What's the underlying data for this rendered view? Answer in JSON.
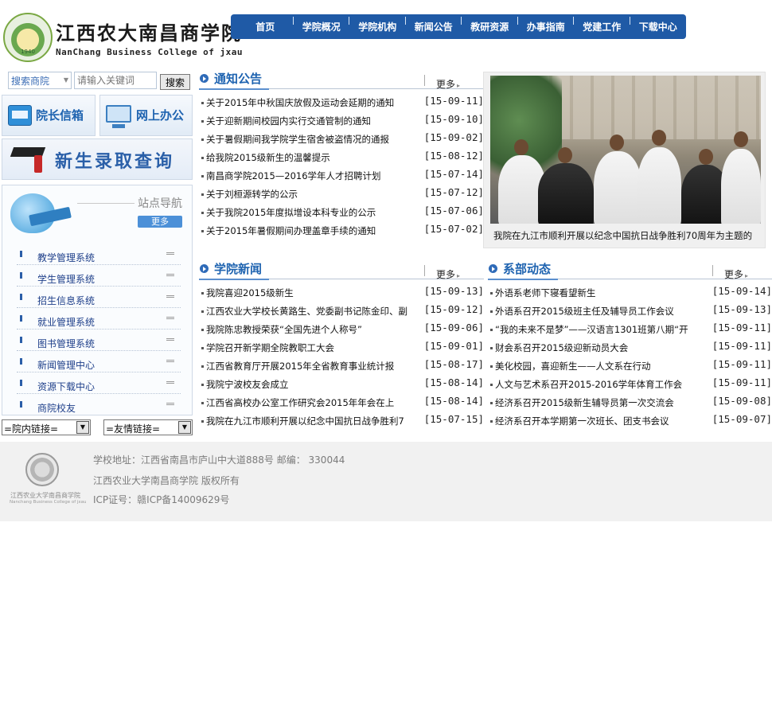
{
  "header": {
    "title_cn": "江西农大南昌商学院",
    "title_en": "NanChang Business College of jxau",
    "logo_year": "1940"
  },
  "nav": {
    "items": [
      "首页",
      "学院概况",
      "学院机构",
      "新闻公告",
      "教研资源",
      "办事指南",
      "党建工作",
      "下载中心"
    ]
  },
  "search": {
    "scope": "搜索商院",
    "placeholder": "请输入关键词",
    "button": "搜索"
  },
  "banners": {
    "president_mail": "院长信箱",
    "online_office": "网上办公",
    "admission_query": "新生录取查询"
  },
  "sitenav": {
    "title": "站点导航",
    "more": "更多",
    "items": [
      "教学管理系统",
      "学生管理系统",
      "招生信息系统",
      "就业管理系统",
      "图书管理系统",
      "新闻管理中心",
      "资源下载中心",
      "商院校友"
    ]
  },
  "link_selects": {
    "internal": "=院内链接=",
    "friend": "=友情链接="
  },
  "notice": {
    "title": "通知公告",
    "more": "更多",
    "items": [
      {
        "title": "关于2015年中秋国庆放假及运动会延期的通知",
        "date": "[15-09-11]"
      },
      {
        "title": "关于迎新期间校园内实行交通管制的通知",
        "date": "[15-09-10]"
      },
      {
        "title": "关于暑假期间我学院学生宿舍被盗情况的通报",
        "date": "[15-09-02]"
      },
      {
        "title": "给我院2015级新生的温馨提示",
        "date": "[15-08-12]"
      },
      {
        "title": "南昌商学院2015—2016学年人才招聘计划",
        "date": "[15-07-14]"
      },
      {
        "title": "关于刘桓源转学的公示",
        "date": "[15-07-12]"
      },
      {
        "title": "关于我院2015年度拟增设本科专业的公示",
        "date": "[15-07-06]"
      },
      {
        "title": "关于2015年暑假期间办理盖章手续的通知",
        "date": "[15-07-02]"
      }
    ]
  },
  "photo": {
    "caption": "我院在九江市顺利开展以纪念中国抗日战争胜利70周年为主题的"
  },
  "college_news": {
    "title": "学院新闻",
    "more": "更多",
    "items": [
      {
        "title": "我院喜迎2015级新生",
        "date": "[15-09-13]"
      },
      {
        "title": "江西农业大学校长黄路生、党委副书记陈金印、副",
        "date": "[15-09-12]"
      },
      {
        "title": "我院陈忠教授荣获“全国先进个人称号”",
        "date": "[15-09-06]"
      },
      {
        "title": "学院召开新学期全院教职工大会",
        "date": "[15-09-01]"
      },
      {
        "title": "江西省教育厅开展2015年全省教育事业统计报",
        "date": "[15-08-17]"
      },
      {
        "title": "我院宁波校友会成立",
        "date": "[15-08-14]"
      },
      {
        "title": "江西省高校办公室工作研究会2015年年会在上",
        "date": "[15-08-14]"
      },
      {
        "title": "我院在九江市顺利开展以纪念中国抗日战争胜利7",
        "date": "[15-07-15]"
      }
    ]
  },
  "dept_news": {
    "title": "系部动态",
    "more": "更多",
    "items": [
      {
        "title": "外语系老师下寝看望新生",
        "date": "[15-09-14]"
      },
      {
        "title": "外语系召开2015级班主任及辅导员工作会议",
        "date": "[15-09-13]"
      },
      {
        "title": "“我的未来不是梦”——汉语言1301班第八期“开",
        "date": "[15-09-11]"
      },
      {
        "title": "财会系召开2015级迎新动员大会",
        "date": "[15-09-11]"
      },
      {
        "title": "美化校园，喜迎新生——人文系在行动",
        "date": "[15-09-11]"
      },
      {
        "title": "人文与艺术系召开2015-2016学年体育工作会",
        "date": "[15-09-11]"
      },
      {
        "title": "经济系召开2015级新生辅导员第一次交流会",
        "date": "[15-09-08]"
      },
      {
        "title": "经济系召开本学期第一次班长、团支书会议",
        "date": "[15-09-07]"
      }
    ]
  },
  "footer": {
    "logo_text": "江西农业大学南昌商学院",
    "logo_text_en": "Nanchang Business College of jxau",
    "address": "学校地址：江西省南昌市庐山中大道888号 邮编： 330044",
    "copyright": "江西农业大学南昌商学院 版权所有",
    "icp": "ICP证号：赣ICP备14009629号"
  }
}
